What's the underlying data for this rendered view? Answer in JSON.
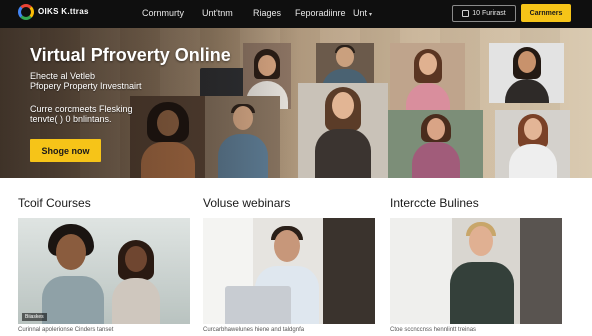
{
  "nav": {
    "logo_line1": "OIKS K.ttras",
    "logo_line2": "",
    "menu": [
      "Cornmurty",
      "Unt'tnm",
      "Riages",
      "Feporadiinre",
      "Unt"
    ],
    "btn_outline": "10 Furirast",
    "btn_primary": "Carnmers"
  },
  "hero": {
    "title": "Virtual Pfroverty Online",
    "sub_line1": "Ehecte al Vetleb",
    "sub_line2": "Pfopery Property Investnairt",
    "sub_line3": "Curre corcmeets Flesking",
    "sub_line4": "tenvte( ) 0 bnlintans.",
    "cta": "Shoge now"
  },
  "sections": [
    {
      "title": "Tcoif Courses",
      "caption": "Curinnal apolerionse Cinders tanset",
      "badge": "Biiaskes"
    },
    {
      "title": "Voluse webinars",
      "caption": "Curcarbhawelunes hiene and taldgnfa",
      "badge": ""
    },
    {
      "title": "Interccte Bulines",
      "caption": "Ctoe sccnccnss hennlintt treinas",
      "badge": ""
    }
  ],
  "colors": {
    "accent": "#f6c418",
    "nav_bg": "#0f0f0f"
  }
}
